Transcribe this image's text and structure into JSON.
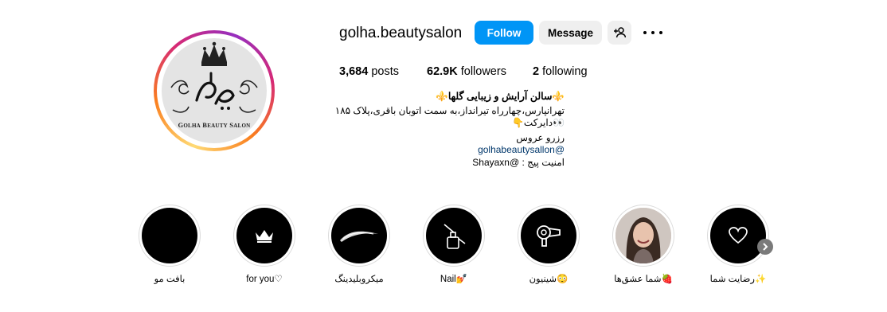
{
  "profile": {
    "username": "golha.beautysalon",
    "avatar_text": "Golha Beauty Salon",
    "avatar_logo_char": "گل‌ها"
  },
  "actions": {
    "follow": "Follow",
    "message": "Message"
  },
  "stats": {
    "posts_count": "3,684",
    "posts_label": " posts",
    "followers_count": "62.9K",
    "followers_label": " followers",
    "following_count": "2",
    "following_label": " following"
  },
  "bio": {
    "name": "⚜️سالن آرایش و زیبایی گلها⚜️",
    "line1": "تهرانپارس،چهارراه تیرانداز،به سمت اتوبان باقری،پلاک ۱۸۵",
    "line2": "👀دایرکت👇",
    "line3": "رزرو عروس",
    "line4": "@golhabeautysallon",
    "line5": "امنیت پیج : @Shayaxn"
  },
  "highlights": [
    {
      "label": "بافت مو"
    },
    {
      "label": "for you♡"
    },
    {
      "label": "میکروبلیدینگ"
    },
    {
      "label": "Nail💅"
    },
    {
      "label": "شینیون😳"
    },
    {
      "label": "شما عشق‌ها🍓"
    },
    {
      "label": "رضایت شما✨"
    }
  ],
  "colors": {
    "follow_button": "#0095f6",
    "secondary_button": "#efefef",
    "link": "#00376b"
  }
}
